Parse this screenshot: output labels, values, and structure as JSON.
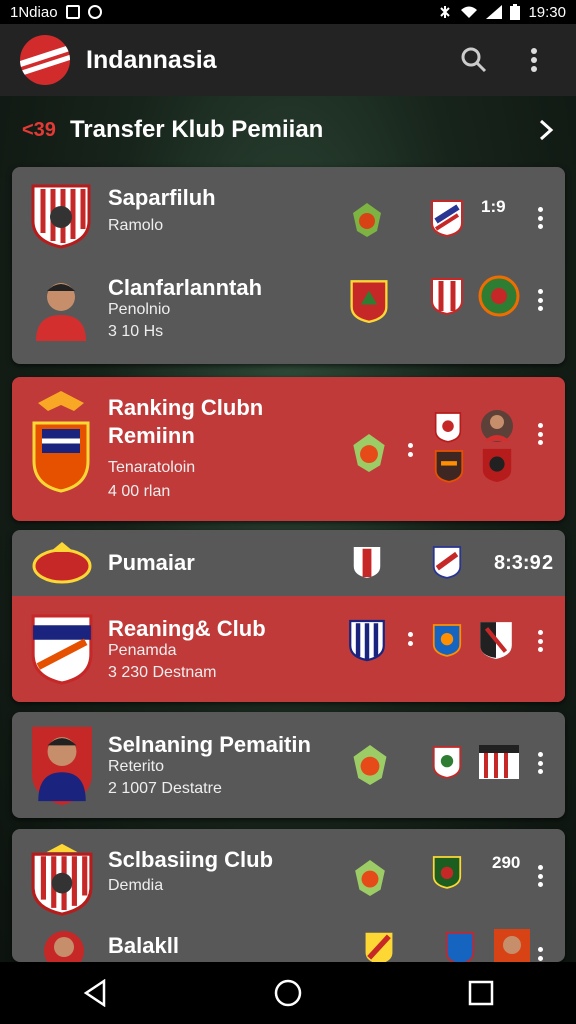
{
  "status_bar": {
    "carrier": "1Ndiao",
    "time": "19:30"
  },
  "app": {
    "title": "Indannasia"
  },
  "section": {
    "back_label": "<39",
    "title": "Transfer Klub Pemiian"
  },
  "cards": [
    {
      "rows": [
        {
          "name": "Saparfiluh",
          "sub1": "Ramolo",
          "value": "1:9"
        },
        {
          "name": "Clanfarlanntah",
          "sub1": "Penolnio",
          "sub2": "3 10 Hs"
        }
      ]
    },
    {
      "rows": [
        {
          "name_line1": "Ranking Clubn",
          "name_line2": "Remiinn",
          "sub1": "Tenaratoloin",
          "sub2": "4 00 rlan"
        }
      ]
    },
    {
      "rows": [
        {
          "name": "Pumaiar",
          "value": "8:3:9",
          "count": "2"
        },
        {
          "name": "Reaning& Club",
          "sub1": "Penamda",
          "sub2": "3 230 Destnam"
        }
      ]
    },
    {
      "rows": [
        {
          "name": "Selnaning Pemaitin",
          "sub1": "Reterito",
          "sub2": "2 1007 Destatre"
        }
      ]
    },
    {
      "rows": [
        {
          "name": "Sclbasiing Club",
          "sub1": "Demdia",
          "value": "290"
        },
        {
          "name": "Balakll"
        }
      ]
    }
  ],
  "colors": {
    "accent_red": "#c13a3a",
    "card_grey": "#585858",
    "app_bar": "#232323",
    "logo_red": "#d22b2b"
  },
  "icons": [
    "wifi-icon",
    "signal-icon",
    "battery-icon",
    "search-icon",
    "more-vert-icon",
    "chevron-right-icon",
    "back-icon",
    "home-icon",
    "recents-icon"
  ]
}
